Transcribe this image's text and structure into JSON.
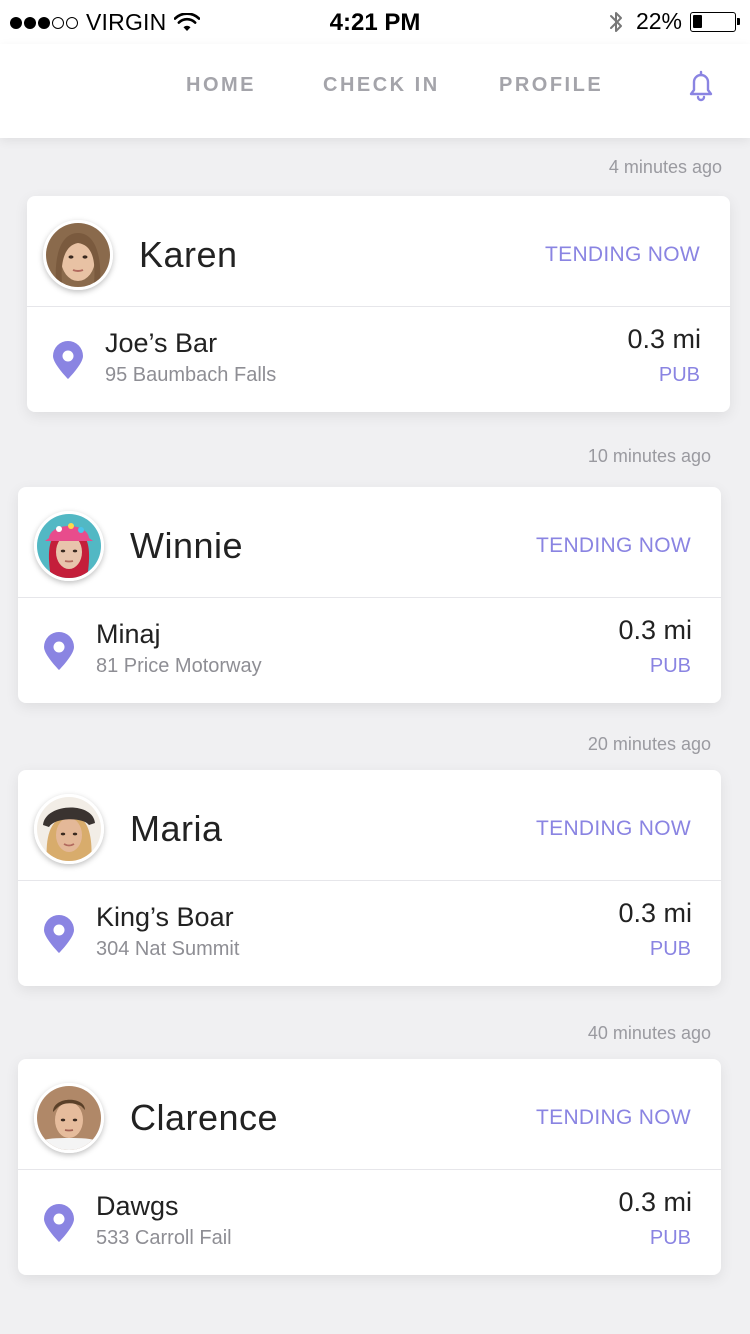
{
  "status_bar": {
    "carrier": "VIRGIN",
    "time": "4:21 PM",
    "battery": "22%",
    "battery_level": 0.22,
    "signal_bars_filled": 3,
    "signal_bars_total": 5,
    "icons": [
      "wifi-icon",
      "bluetooth-icon",
      "battery-icon"
    ]
  },
  "nav": {
    "home": "HOME",
    "checkin": "CHECK IN",
    "profile": "PROFILE",
    "notifications_icon": "bell-icon"
  },
  "colors": {
    "accent": "#8a84e2",
    "text_primary": "#222222",
    "text_secondary": "#8e8e94",
    "background": "#f0f0f2"
  },
  "feed": [
    {
      "time_ago": "4 minutes ago",
      "name": "Karen",
      "status": "TENDING NOW",
      "venue": "Joe’s Bar",
      "address": "95 Baumbach Falls",
      "distance": "0.3 mi",
      "category": "PUB"
    },
    {
      "time_ago": "10 minutes ago",
      "name": "Winnie",
      "status": "TENDING NOW",
      "venue": "Minaj",
      "address": "81 Price Motorway",
      "distance": "0.3 mi",
      "category": "PUB"
    },
    {
      "time_ago": "20 minutes ago",
      "name": "Maria",
      "status": "TENDING NOW",
      "venue": "King’s Boar",
      "address": "304 Nat Summit",
      "distance": "0.3 mi",
      "category": "PUB"
    },
    {
      "time_ago": "40 minutes ago",
      "name": "Clarence",
      "status": "TENDING NOW",
      "venue": "Dawgs",
      "address": "533 Carroll Fail",
      "distance": "0.3 mi",
      "category": "PUB"
    }
  ]
}
